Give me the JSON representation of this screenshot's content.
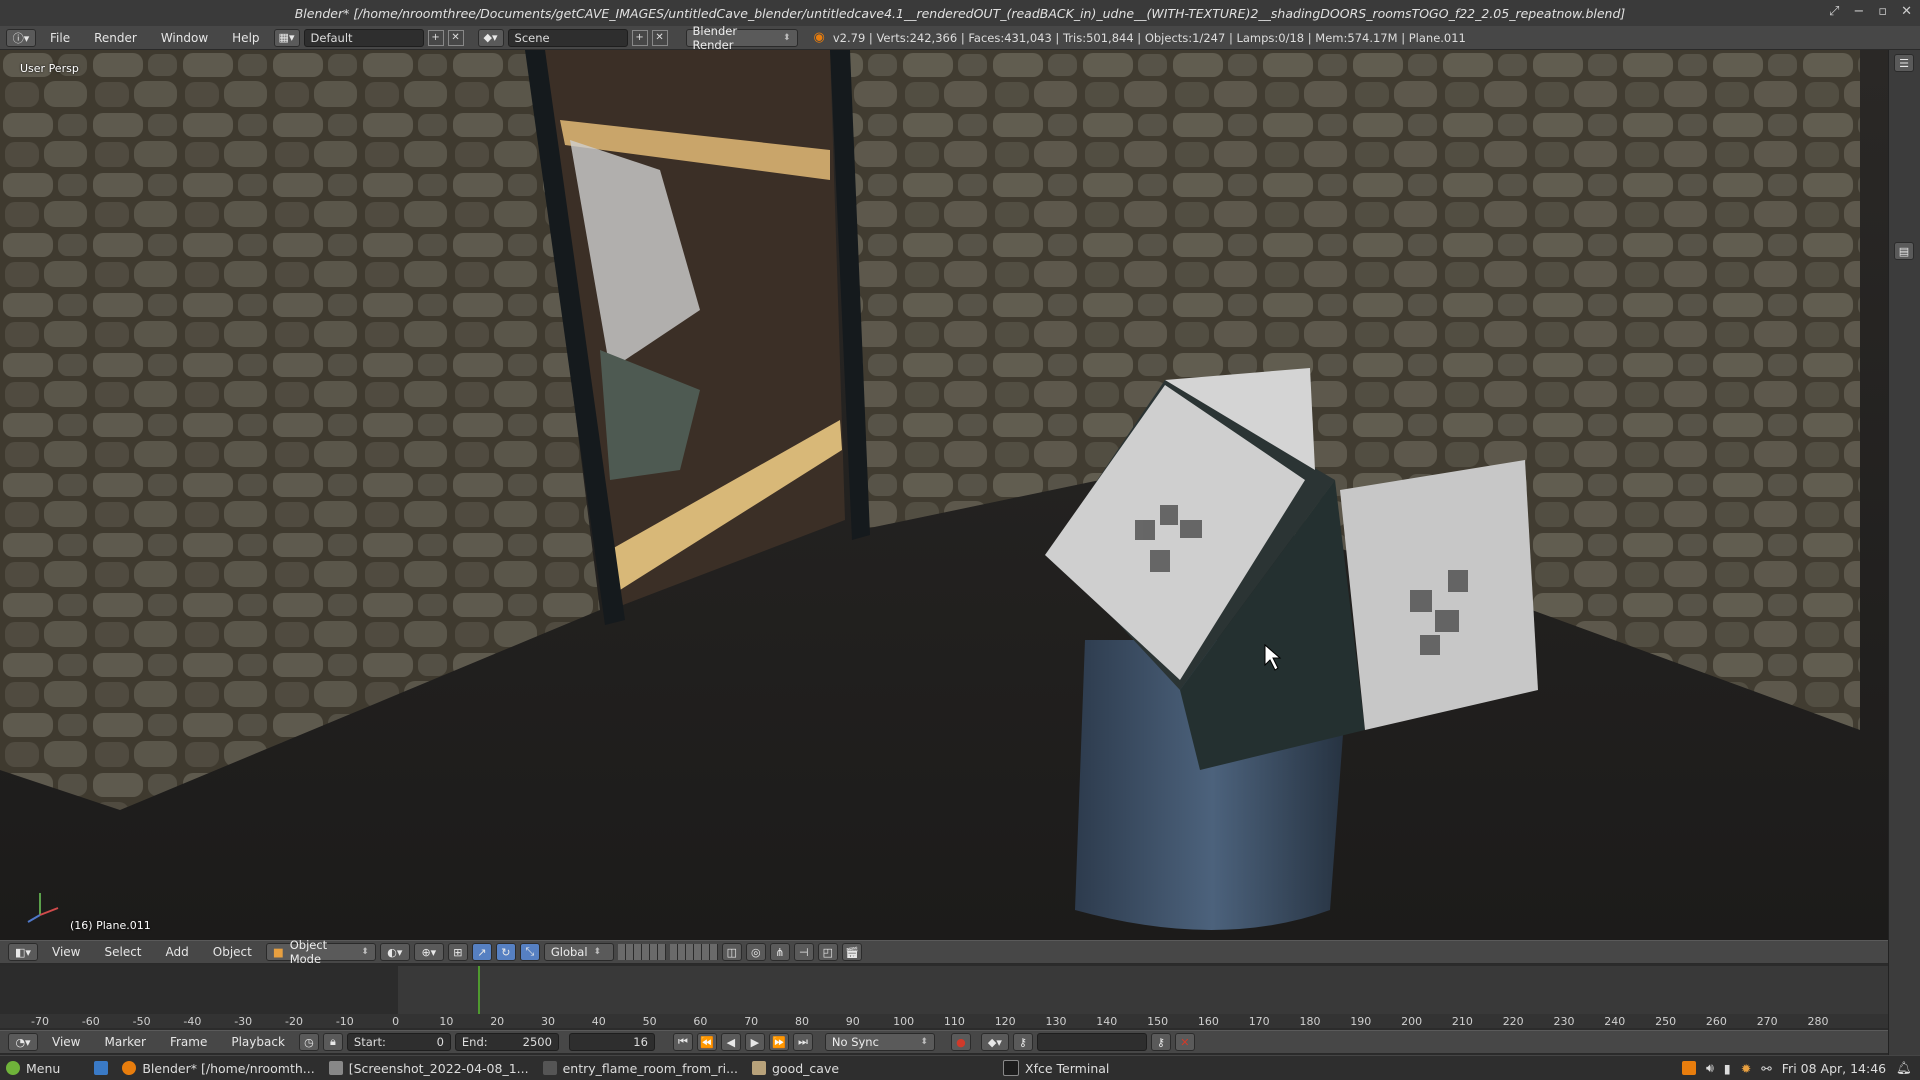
{
  "window": {
    "title": "Blender* [/home/nroomthree/Documents/getCAVE_IMAGES/untitledCave_blender/untitledcave4.1__renderedOUT_(readBACK_in)_udne__(WITH-TEXTURE)2__shadingDOORS_roomsTOGO_f22_2.05_repeatnow.blend]"
  },
  "info_header": {
    "menus": [
      "File",
      "Render",
      "Window",
      "Help"
    ],
    "layout_name": "Default",
    "scene_name": "Scene",
    "engine": "Blender Render",
    "stats": "v2.79 | Verts:242,366 | Faces:431,043 | Tris:501,844 | Objects:1/247 | Lamps:0/18 | Mem:574.17M | Plane.011"
  },
  "viewport": {
    "view_label": "User Persp",
    "object_label": "(16) Plane.011"
  },
  "view3d_header": {
    "menus": [
      "View",
      "Select",
      "Add",
      "Object"
    ],
    "mode": "Object Mode",
    "orientation": "Global"
  },
  "timeline": {
    "tick_labels": [
      "-70",
      "-60",
      "-50",
      "-40",
      "-30",
      "-20",
      "-10",
      "0",
      "10",
      "20",
      "30",
      "40",
      "50",
      "60",
      "70",
      "80",
      "90",
      "100",
      "110",
      "120",
      "130",
      "140",
      "150",
      "160",
      "170",
      "180",
      "190",
      "200",
      "210",
      "220",
      "230",
      "240",
      "250",
      "260",
      "270",
      "280"
    ],
    "current_frame_indicator": 16
  },
  "timeline_header": {
    "menus": [
      "View",
      "Marker",
      "Frame",
      "Playback"
    ],
    "start_label": "Start:",
    "start_value": "0",
    "end_label": "End:",
    "end_value": "2500",
    "current_frame": "16",
    "sync": "No Sync"
  },
  "taskbar": {
    "menu_label": "Menu",
    "tasks": [
      "Blender* [/home/nroomth...",
      "[Screenshot_2022-04-08_1...",
      "entry_flame_room_from_ri...",
      "good_cave",
      "Xfce Terminal"
    ],
    "clock": "Fri 08 Apr, 14:46"
  },
  "colors": {
    "header_bg": "#474747",
    "accent_blue": "#5680c2",
    "playhead_green": "#4f9a2f",
    "blender_orange": "#e87d0d"
  }
}
